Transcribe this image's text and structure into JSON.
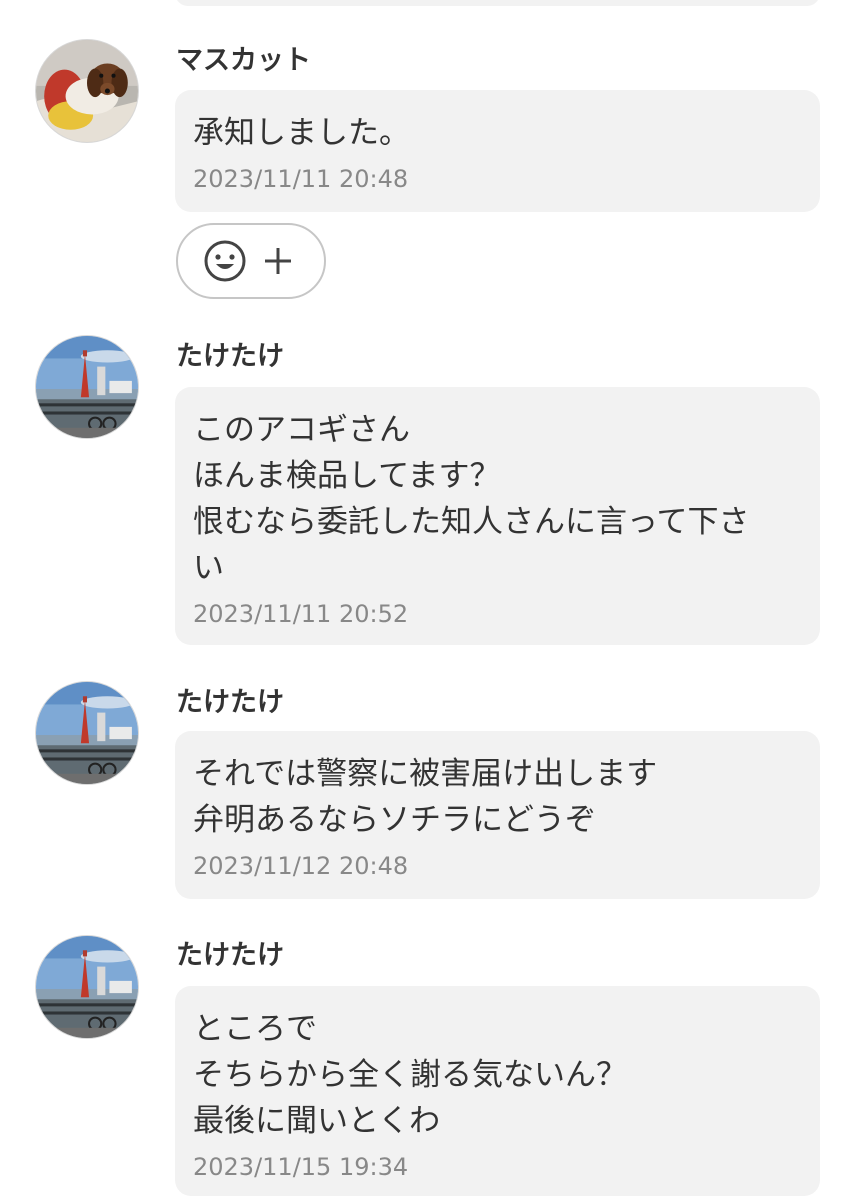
{
  "messages": [
    {
      "sender": "マスカット",
      "avatar_icon": "dachshund-avatar-icon",
      "lines": [
        "承知しました。"
      ],
      "time": "2023/11/11 20:48"
    },
    {
      "sender": "たけたけ",
      "avatar_icon": "port-tower-avatar-icon",
      "lines": [
        "このアコギさん",
        "ほんま検品してます？",
        "恨むなら委託した知人さんに言って下さ",
        "い"
      ],
      "time": "2023/11/11 20:52"
    },
    {
      "sender": "たけたけ",
      "avatar_icon": "port-tower-avatar-icon",
      "lines": [
        "それでは警察に被害届け出します",
        "弁明あるならソチラにどうぞ"
      ],
      "time": "2023/11/12 20:48"
    },
    {
      "sender": "たけたけ",
      "avatar_icon": "port-tower-avatar-icon",
      "lines": [
        "ところで",
        "そちらから全く謝る気ないん？",
        "最後に聞いとくわ"
      ],
      "time": "2023/11/15 19:34"
    }
  ],
  "reaction": {
    "emoji_icon": "smiley-face-icon",
    "add_icon": "plus-icon"
  },
  "colors": {
    "bubble_bg": "#f2f2f2",
    "text": "#333333",
    "timestamp": "#888888",
    "pill_border": "#c6c6c6"
  }
}
